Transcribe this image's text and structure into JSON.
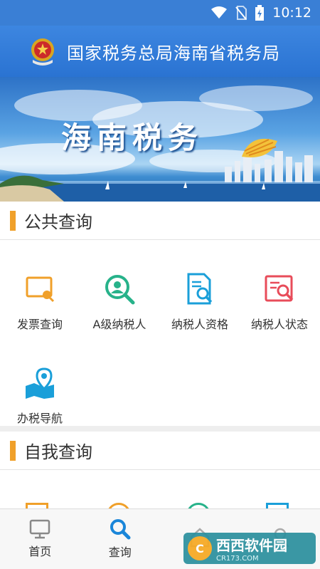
{
  "status_bar": {
    "time": "10:12"
  },
  "header": {
    "title": "国家税务总局海南省税务局"
  },
  "banner": {
    "text": "海南税务"
  },
  "public_query": {
    "title": "公共查询",
    "items": [
      {
        "label": "发票查询",
        "icon": "invoice-icon",
        "color": "#f0a02a"
      },
      {
        "label": "A级纳税人",
        "icon": "search-person-icon",
        "color": "#27b28a"
      },
      {
        "label": "纳税人资格",
        "icon": "document-search-icon",
        "color": "#1a9fd9"
      },
      {
        "label": "纳税人状态",
        "icon": "report-search-icon",
        "color": "#e84c5a"
      },
      {
        "label": "办税导航",
        "icon": "map-pin-icon",
        "color": "#1a9fd9"
      }
    ]
  },
  "self_query": {
    "title": "自我查询"
  },
  "tab_bar": {
    "items": [
      {
        "label": "首页",
        "icon": "monitor-icon"
      },
      {
        "label": "查询",
        "icon": "search-icon",
        "active": true
      },
      {
        "label": "",
        "icon": "home-icon"
      },
      {
        "label": "",
        "icon": "user-icon"
      }
    ]
  },
  "watermark": {
    "main": "西西软件园",
    "sub": "CR173.COM",
    "logo": "C"
  },
  "colors": {
    "header_blue": "#2a73d2",
    "accent_orange": "#f0a02a",
    "active_blue": "#1a86d9"
  }
}
